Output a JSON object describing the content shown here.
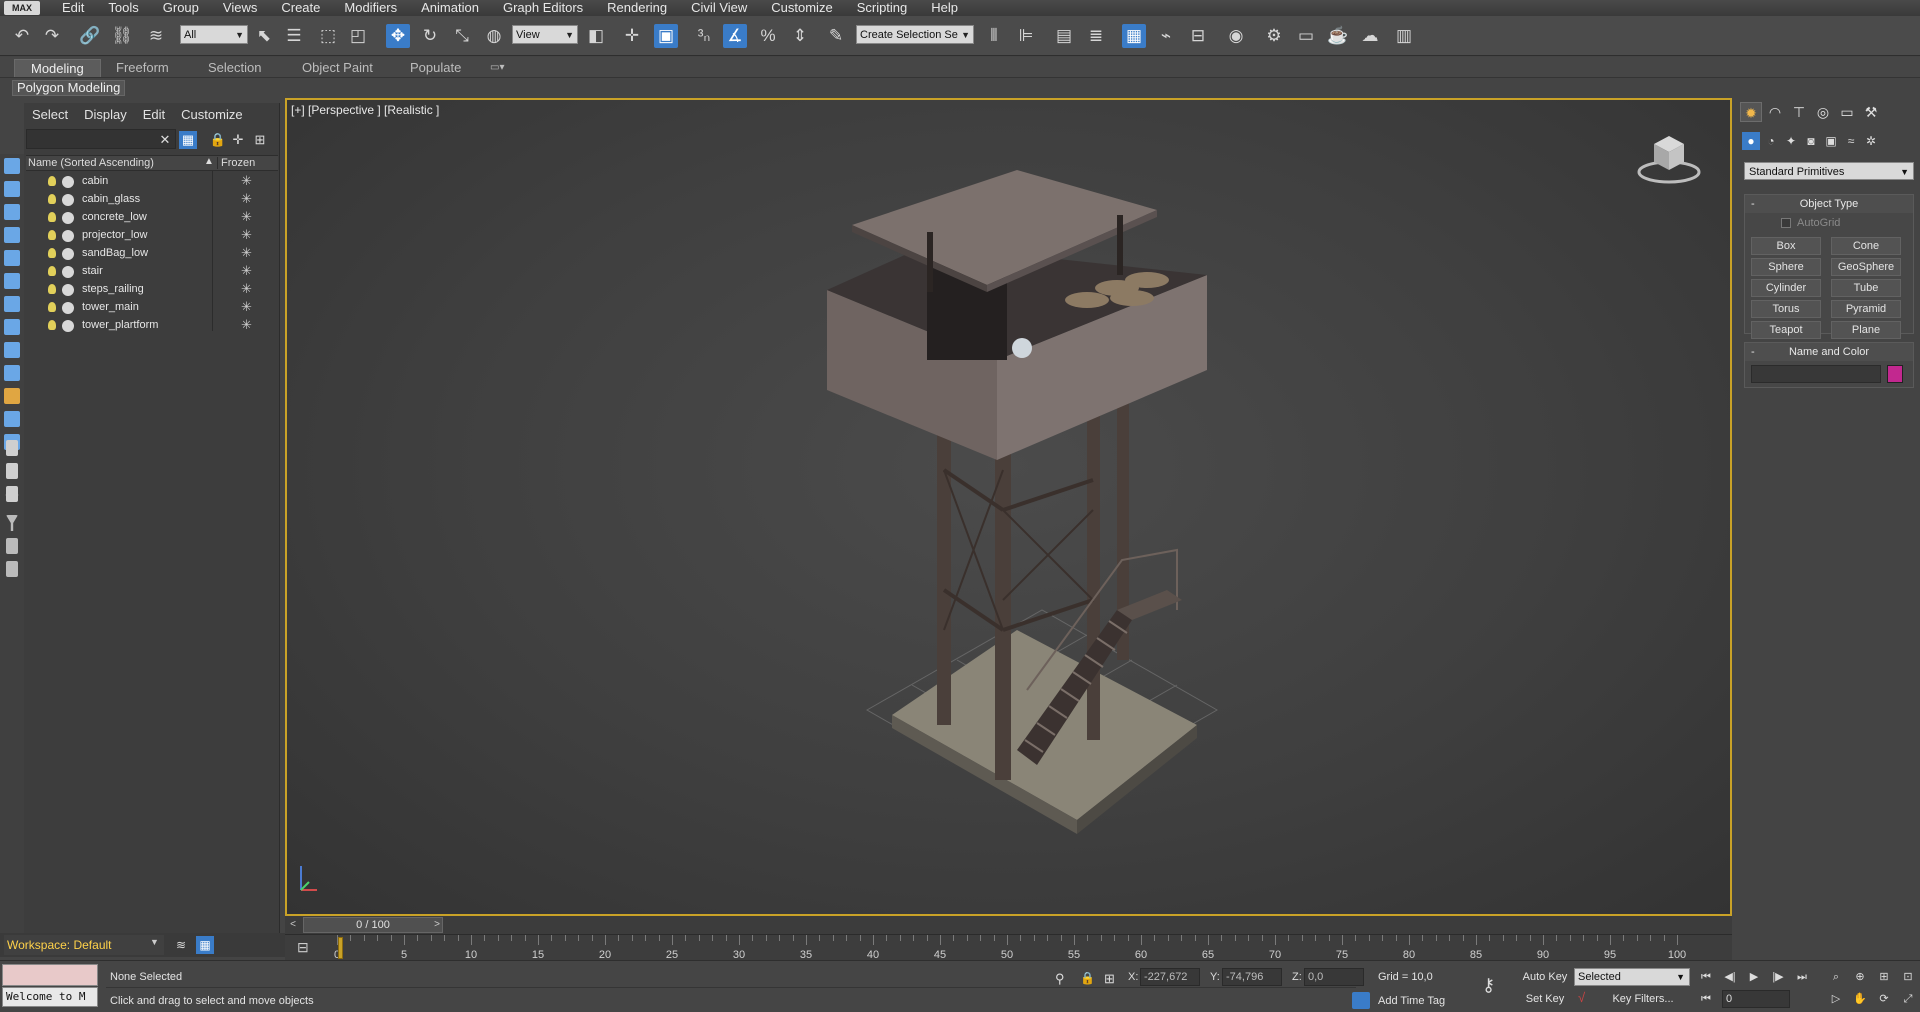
{
  "app": {
    "badge": "MAX"
  },
  "menu": [
    "Edit",
    "Tools",
    "Group",
    "Views",
    "Create",
    "Modifiers",
    "Animation",
    "Graph Editors",
    "Rendering",
    "Civil View",
    "Customize",
    "Scripting",
    "Help"
  ],
  "toolbar": {
    "selection_filter": "All",
    "reference_coord": "View",
    "named_selection_placeholder": "Create Selection Se"
  },
  "ribbon": {
    "tabs": [
      "Modeling",
      "Freeform",
      "Selection",
      "Object Paint",
      "Populate"
    ],
    "active_tab": "Modeling",
    "sub_label": "Polygon Modeling"
  },
  "explorer": {
    "menu": [
      "Select",
      "Display",
      "Edit",
      "Customize"
    ],
    "col_name": "Name (Sorted Ascending)",
    "col_frozen": "Frozen",
    "objects": [
      "cabin",
      "cabin_glass",
      "concrete_low",
      "projector_low",
      "sandBag_low",
      "stair",
      "steps_railing",
      "tower_main",
      "tower_plartform"
    ]
  },
  "viewport": {
    "label": "[+] [Perspective ] [Realistic ]"
  },
  "command_panel": {
    "category": "Standard Primitives",
    "object_type_title": "Object Type",
    "autogrid": "AutoGrid",
    "primitives": [
      "Box",
      "Cone",
      "Sphere",
      "GeoSphere",
      "Cylinder",
      "Tube",
      "Torus",
      "Pyramid",
      "Teapot",
      "Plane"
    ],
    "name_color_title": "Name and Color",
    "object_color": "#c2288f"
  },
  "timeline": {
    "position": "0 / 100",
    "ticks": [
      0,
      5,
      10,
      15,
      20,
      25,
      30,
      35,
      40,
      45,
      50,
      55,
      60,
      65,
      70,
      75,
      80,
      85,
      90,
      95,
      100
    ]
  },
  "workspace": {
    "label": "Workspace: Default"
  },
  "status": {
    "maxscript_text": "Welcome to M",
    "selection": "None Selected",
    "prompt": "Click and drag to select and move objects",
    "x_label": "X:",
    "x_value": "-227,672",
    "y_label": "Y:",
    "y_value": "-74,796",
    "z_label": "Z:",
    "z_value": "0,0",
    "grid": "Grid = 10,0",
    "add_time_tag": "Add Time Tag",
    "auto_key": "Auto Key",
    "set_key": "Set Key",
    "key_mode": "Selected",
    "key_filters": "Key Filters...",
    "frame": "0"
  }
}
